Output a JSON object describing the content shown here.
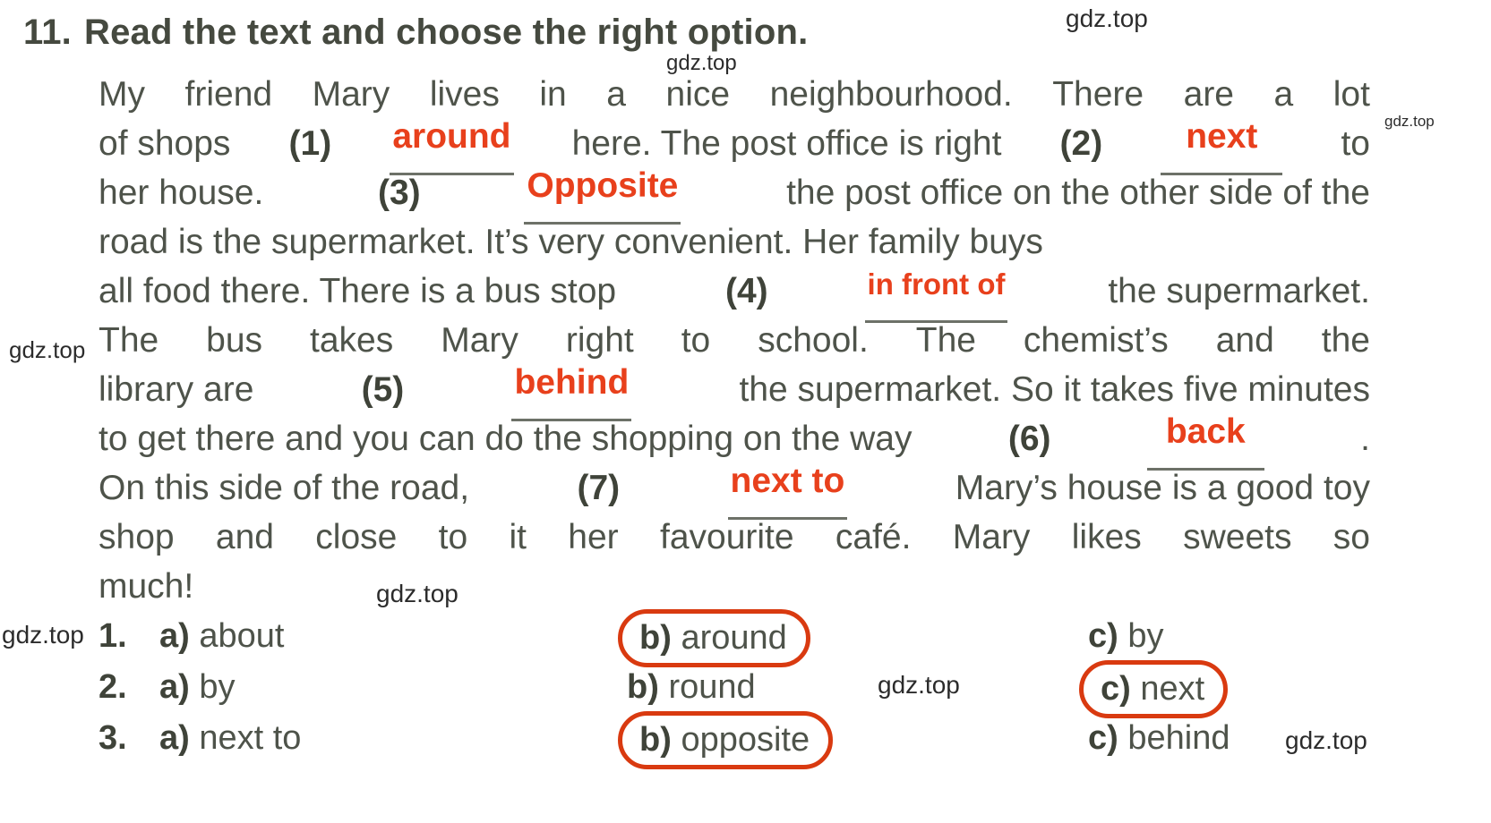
{
  "exercise": {
    "number": "11.",
    "title": "Read the text and choose the right option."
  },
  "passage": {
    "lines": [
      {
        "id": "l1",
        "segments": [
          {
            "type": "text",
            "value": "My friend Mary lives in a nice neighbourhood. There are a lot"
          }
        ]
      },
      {
        "id": "l2",
        "segments": [
          {
            "type": "text",
            "value": "of shops"
          },
          {
            "type": "marker",
            "value": "(1)"
          },
          {
            "type": "fill",
            "value": "around"
          },
          {
            "type": "text",
            "value": "here. The post office is right"
          },
          {
            "type": "marker",
            "value": "(2)"
          },
          {
            "type": "fill",
            "value": "next"
          },
          {
            "type": "text",
            "value": "to"
          }
        ]
      },
      {
        "id": "l3",
        "segments": [
          {
            "type": "text",
            "value": "her house."
          },
          {
            "type": "marker",
            "value": "(3)"
          },
          {
            "type": "fill",
            "value": "Opposite"
          },
          {
            "type": "text",
            "value": "the post office on the other side of the"
          }
        ]
      },
      {
        "id": "l4",
        "segments": [
          {
            "type": "text",
            "value": "road is the supermarket. It’s very convenient. Her family buys"
          }
        ]
      },
      {
        "id": "l5",
        "segments": [
          {
            "type": "text",
            "value": "all food there. There is a bus stop"
          },
          {
            "type": "marker",
            "value": "(4)"
          },
          {
            "type": "fill",
            "value": "in front of"
          },
          {
            "type": "text",
            "value": "the supermarket."
          }
        ]
      },
      {
        "id": "l6",
        "segments": [
          {
            "type": "text",
            "value": "The bus takes Mary right to school. The chemist’s and the"
          }
        ]
      },
      {
        "id": "l7",
        "segments": [
          {
            "type": "text",
            "value": "library are"
          },
          {
            "type": "marker",
            "value": "(5)"
          },
          {
            "type": "fill",
            "value": "behind"
          },
          {
            "type": "text",
            "value": "the supermarket. So it takes five minutes"
          }
        ]
      },
      {
        "id": "l8",
        "segments": [
          {
            "type": "text",
            "value": "to get there and you can do the shopping on the way"
          },
          {
            "type": "marker",
            "value": "(6)"
          },
          {
            "type": "fill",
            "value": "back"
          },
          {
            "type": "text",
            "value": "."
          }
        ]
      },
      {
        "id": "l9",
        "segments": [
          {
            "type": "text",
            "value": "On this side of the road,"
          },
          {
            "type": "marker",
            "value": "(7)"
          },
          {
            "type": "fill",
            "value": "next to"
          },
          {
            "type": "text",
            "value": "Mary’s house is a good toy"
          }
        ]
      },
      {
        "id": "l10",
        "segments": [
          {
            "type": "text",
            "value": "shop and close to it her favourite café. Mary likes sweets so"
          }
        ]
      },
      {
        "id": "l11",
        "segments": [
          {
            "type": "text",
            "value": "much!"
          }
        ]
      }
    ],
    "text_l1_a": "My",
    "text_l1_b": "friend",
    "text_l1_c": "Mary",
    "text_l1_d": "lives",
    "text_l1_e": "in",
    "text_l1_f": "a",
    "text_l1_g": "nice",
    "text_l1_h": "neighbourhood.",
    "text_l1_i": "There",
    "text_l1_j": "are",
    "text_l1_k": "a",
    "text_l1_l": "lot",
    "l2_p1": "of shops",
    "l2_m1": "(1)",
    "l2_f1": "around",
    "l2_p2": "here. The post office is right",
    "l2_m2": "(2)",
    "l2_f2": "next",
    "l2_p3": "to",
    "l3_p1": "her house.",
    "l3_m1": "(3)",
    "l3_f1": "Opposite",
    "l3_p2": "the post office on the other side of the",
    "l4_full": "road is the supermarket. It’s very convenient. Her family buys",
    "l5_p1": "all food there. There is a bus stop",
    "l5_m1": "(4)",
    "l5_f1": "in front of",
    "l5_p2": "the supermarket.",
    "l6_a": "The",
    "l6_b": "bus",
    "l6_c": "takes",
    "l6_d": "Mary",
    "l6_e": "right",
    "l6_f": "to",
    "l6_g": "school.",
    "l6_h": "The",
    "l6_i": "chemist’s",
    "l6_j": "and",
    "l6_k": "the",
    "l7_p1": "library are",
    "l7_m1": "(5)",
    "l7_f1": "behind",
    "l7_p2": "the supermarket. So it takes five minutes",
    "l8_p1": "to get there and you can do the shopping on the way",
    "l8_m1": "(6)",
    "l8_f1": "back",
    "l8_p2": ".",
    "l9_p1": "On this side of the road,",
    "l9_m1": "(7)",
    "l9_f1": "next to",
    "l9_p2": "Mary’s house is a good toy",
    "l10_a": "shop",
    "l10_b": "and",
    "l10_c": "close",
    "l10_d": "to",
    "l10_e": "it",
    "l10_f": "her",
    "l10_g": "favourite",
    "l10_h": "café.",
    "l10_i": "Mary",
    "l10_j": "likes",
    "l10_k": "sweets",
    "l10_l": "so",
    "l11_full": "much!"
  },
  "options": {
    "rows": [
      {
        "index": "1.",
        "a_letter": "a)",
        "a_text": "about",
        "b_letter": "b)",
        "b_text": "around",
        "c_letter": "c)",
        "c_text": "by",
        "selected": "b"
      },
      {
        "index": "2.",
        "a_letter": "a)",
        "a_text": "by",
        "b_letter": "b)",
        "b_text": "round",
        "c_letter": "c)",
        "c_text": "next",
        "selected": "c"
      },
      {
        "index": "3.",
        "a_letter": "a)",
        "a_text": "next to",
        "b_letter": "b)",
        "b_text": "opposite",
        "c_letter": "c)",
        "c_text": "behind",
        "selected": "b"
      }
    ],
    "r1_index": "1.",
    "r1_a_letter": "a)",
    "r1_a_text": "about",
    "r1_b_letter": "b)",
    "r1_b_text": "around",
    "r1_c_letter": "c)",
    "r1_c_text": "by",
    "r2_index": "2.",
    "r2_a_letter": "a)",
    "r2_a_text": "by",
    "r2_b_letter": "b)",
    "r2_b_text": "round",
    "r2_c_letter": "c)",
    "r2_c_text": "next",
    "r3_index": "3.",
    "r3_a_letter": "a)",
    "r3_a_text": "next to",
    "r3_b_letter": "b)",
    "r3_b_text": "opposite",
    "r3_c_letter": "c)",
    "r3_c_text": "behind"
  },
  "watermarks": {
    "w1": "gdz.top",
    "w2": "gdz.top",
    "w3": "gdz.top",
    "w4": "gdz.top",
    "w5": "gdz.top",
    "w6": "gdz.top",
    "w7": "gdz.top",
    "w8": "gdz.top",
    "w9": "gdz.top"
  },
  "colors": {
    "answer_red": "#e8401c",
    "circle_red": "#d93a10",
    "body_text": "#4e534a",
    "blank_rule": "#6d7168",
    "background": "#ffffff"
  }
}
